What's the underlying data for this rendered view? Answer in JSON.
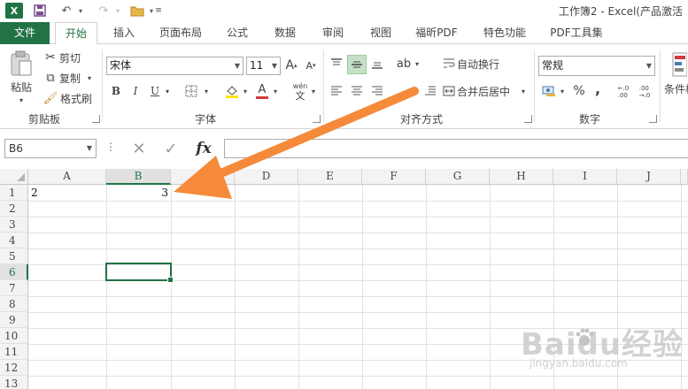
{
  "title_bar": {
    "app_icon": "excel-logo",
    "title": "工作簿2 - Excel(产品激活"
  },
  "tabs": [
    "文件",
    "开始",
    "插入",
    "页面布局",
    "公式",
    "数据",
    "审阅",
    "视图",
    "福昕PDF",
    "特色功能",
    "PDF工具集"
  ],
  "ribbon": {
    "clipboard": {
      "label": "剪贴板",
      "paste": "粘贴",
      "cut": "剪切",
      "copy": "复制",
      "format_painter": "格式刷"
    },
    "font": {
      "label": "字体",
      "font_name": "宋体",
      "font_size": "11",
      "wen": "wén",
      "wen_char": "文"
    },
    "alignment": {
      "label": "对齐方式",
      "wrap_text": "自动换行",
      "merge_center": "合并后居中"
    },
    "number": {
      "label": "数字",
      "format": "常规",
      "percent": "%",
      "comma": ",",
      "inc_decimal": "←.0\n.00",
      "dec_decimal": ".00\n→.0"
    },
    "styles": {
      "conditional": "条件格"
    }
  },
  "formula_bar": {
    "name_box": "B6",
    "fx": "fx",
    "formula": ""
  },
  "sheet": {
    "columns": [
      "A",
      "B",
      "C",
      "D",
      "E",
      "F",
      "G",
      "H",
      "I",
      "J"
    ],
    "rows": [
      "1",
      "2",
      "3",
      "4",
      "5",
      "6",
      "7",
      "8",
      "9",
      "10",
      "11",
      "12",
      "13"
    ],
    "selected_cell": "B6",
    "cells": {
      "A1": "2",
      "B1": "3"
    }
  },
  "accent_colors": {
    "excel_green": "#217346",
    "annotation_arrow": "#f58a3a",
    "font_color_red": "#d23a3a",
    "fill_yellow": "#ffe500"
  },
  "watermark": {
    "brand": "Baidu经验",
    "url": "jingyan.baidu.com"
  }
}
